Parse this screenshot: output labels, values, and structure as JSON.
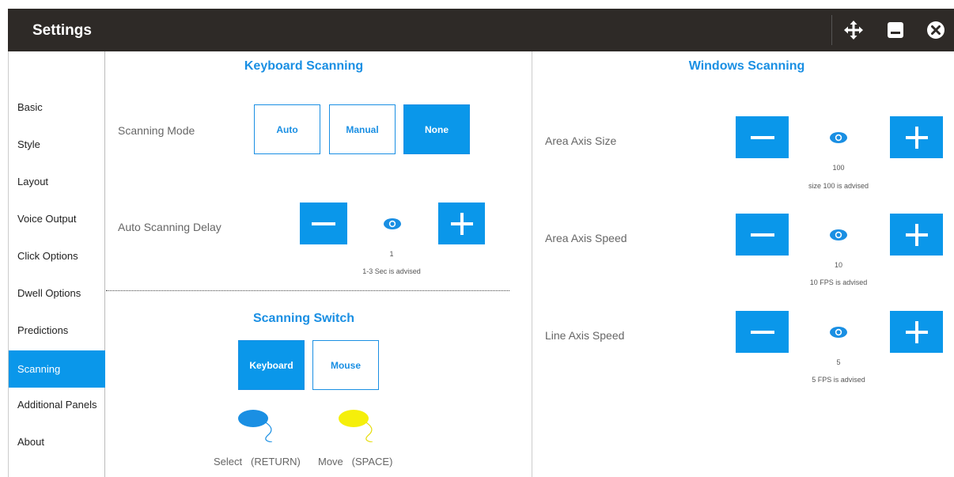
{
  "window": {
    "title": "Settings",
    "move_icon": "move-icon",
    "minimize_icon": "minimize-icon",
    "close_icon": "close-icon"
  },
  "sidebar": {
    "items": [
      {
        "label": "Basic",
        "active": false
      },
      {
        "label": "Style",
        "active": false
      },
      {
        "label": "Layout",
        "active": false
      },
      {
        "label": "Voice Output",
        "active": false
      },
      {
        "label": "Click Options",
        "active": false
      },
      {
        "label": "Dwell Options",
        "active": false
      },
      {
        "label": "Predictions",
        "active": false
      },
      {
        "label": "Scanning",
        "active": true
      },
      {
        "label": "Additional Panels",
        "active": false
      },
      {
        "label": "About",
        "active": false
      }
    ]
  },
  "keyboard_scanning": {
    "heading": "Keyboard Scanning",
    "mode": {
      "label": "Scanning Mode",
      "options": [
        "Auto",
        "Manual",
        "None"
      ],
      "selected": "None"
    },
    "delay": {
      "label": "Auto Scanning Delay",
      "value": "1",
      "hint": "1-3 Sec is advised"
    }
  },
  "scanning_switch": {
    "heading": "Scanning Switch",
    "options": [
      "Keyboard",
      "Mouse"
    ],
    "selected": "Keyboard",
    "select_label": "Select",
    "select_key": "(RETURN)",
    "move_label": "Move",
    "move_key": "(SPACE)",
    "select_color": "#1a8fe3",
    "move_color": "#f5ef0a"
  },
  "windows_scanning": {
    "heading": "Windows Scanning",
    "rows": [
      {
        "label": "Area Axis Size",
        "value": "100",
        "hint": "size 100 is advised"
      },
      {
        "label": "Area Axis Speed",
        "value": "10",
        "hint": "10 FPS is advised"
      },
      {
        "label": "Line Axis Speed",
        "value": "5",
        "hint": "5 FPS is advised"
      }
    ]
  },
  "colors": {
    "accent": "#0a97ea",
    "titlebar": "#2e2a27"
  }
}
